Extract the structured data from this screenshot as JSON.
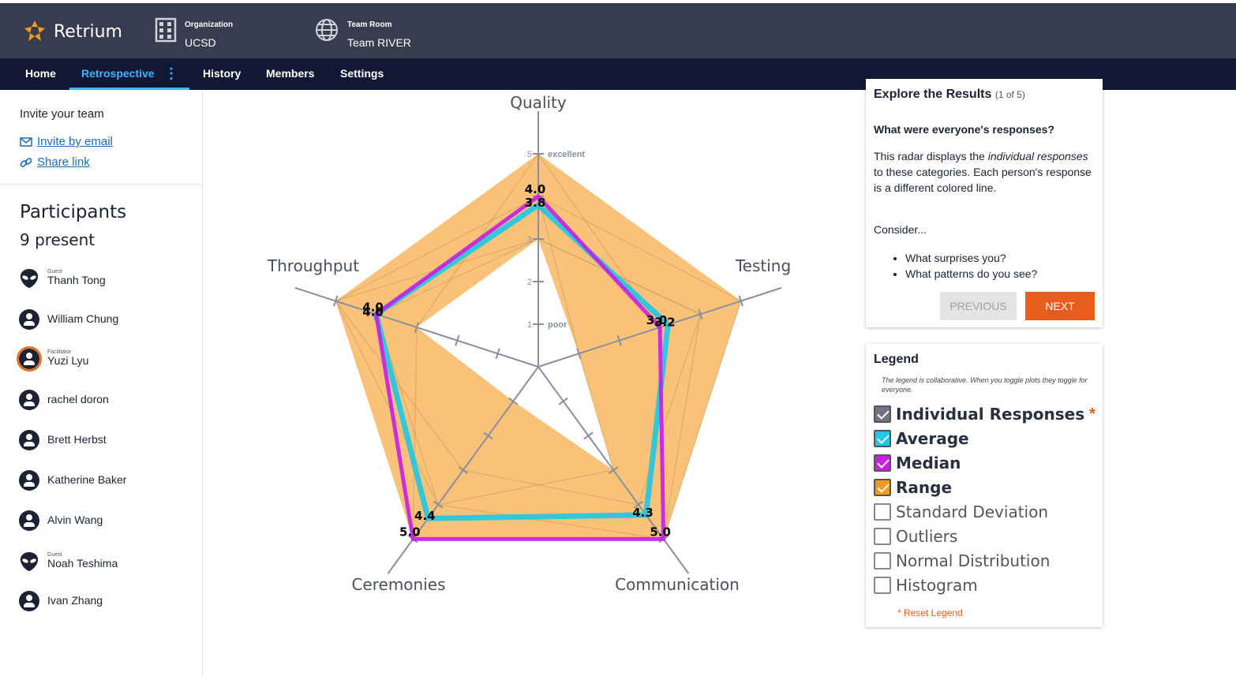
{
  "app": {
    "name": "Retrium"
  },
  "header": {
    "org_label": "Organization",
    "org_value": "UCSD",
    "room_label": "Team Room",
    "room_value": "Team RIVER"
  },
  "nav": {
    "home": "Home",
    "retro": "Retrospective",
    "history": "History",
    "members": "Members",
    "settings": "Settings"
  },
  "sidebar": {
    "invite_title": "Invite your team",
    "invite_email": "Invite by email",
    "share_link": "Share link",
    "participants_title": "Participants",
    "present": "9 present",
    "people": [
      {
        "role": "Guest",
        "name": "Thanh Tong"
      },
      {
        "role": "",
        "name": "William Chung"
      },
      {
        "role": "Facilitator",
        "name": "Yuzi Lyu"
      },
      {
        "role": "",
        "name": "rachel doron"
      },
      {
        "role": "",
        "name": "Brett Herbst"
      },
      {
        "role": "",
        "name": "Katherine Baker"
      },
      {
        "role": "",
        "name": "Alvin Wang"
      },
      {
        "role": "Guest",
        "name": "Noah Teshima"
      },
      {
        "role": "",
        "name": "Ivan Zhang"
      }
    ]
  },
  "explore": {
    "title": "Explore the Results",
    "counter": "(1 of 5)",
    "question": "What were everyone's responses?",
    "body_pre": "This radar displays the ",
    "body_em": "individual responses",
    "body_post": " to these categories. Each person's response is a different colored line.",
    "consider": "Consider...",
    "bullets": [
      "What surprises you?",
      "What patterns do you see?"
    ],
    "previous": "PREVIOUS",
    "next": "NEXT"
  },
  "legend": {
    "title": "Legend",
    "note": "The legend is collaborative. When you toggle plots they toggle for everyone.",
    "items": [
      {
        "label": "Individual Responses",
        "checked": true,
        "color": "#707585",
        "asterisk": "*"
      },
      {
        "label": "Average",
        "checked": true,
        "color": "#1ec8e6"
      },
      {
        "label": "Median",
        "checked": true,
        "color": "#c81ee6"
      },
      {
        "label": "Range",
        "checked": true,
        "color": "#f39a1c"
      },
      {
        "label": "Standard Deviation",
        "checked": false
      },
      {
        "label": "Outliers",
        "checked": false
      },
      {
        "label": "Normal Distribution",
        "checked": false
      },
      {
        "label": "Histogram",
        "checked": false
      }
    ],
    "reset": "* Reset Legend"
  },
  "chart_data": {
    "type": "radar",
    "axes": [
      "Quality",
      "Testing",
      "Communication",
      "Ceremonies",
      "Throughput"
    ],
    "scale_ticks": [
      "1",
      "2",
      "3",
      "5"
    ],
    "scale_words": {
      "1": "poor",
      "5": "excellent"
    },
    "rmax": 5,
    "range": {
      "min": [
        3,
        1,
        3,
        1,
        3
      ],
      "max": [
        5,
        5,
        5,
        5,
        5
      ]
    },
    "average": {
      "values": [
        3.8,
        3.2,
        4.3,
        4.4,
        4.0
      ],
      "labels": [
        "3.8",
        "3.2",
        "4.3",
        "4.4",
        "4.0"
      ],
      "color": "#1ec8e6"
    },
    "median": {
      "values": [
        4.0,
        3.0,
        5.0,
        5.0,
        4.0
      ],
      "labels": [
        "4.0",
        "3.0",
        "5.0",
        "5.0",
        "4.0"
      ],
      "color": "#c81ee6"
    },
    "range_color": "#f7ad4b"
  }
}
